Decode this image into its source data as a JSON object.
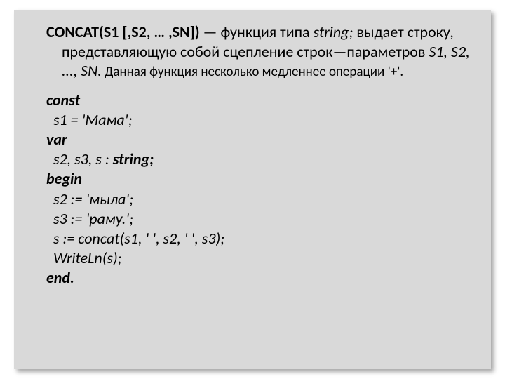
{
  "desc": {
    "sig": "CONCAT(S1 [,S2, … ,SN])",
    "dash": " — функция типа ",
    "type": "string;",
    "body1": " выдает строку, представляющую собой сцепление строк—параметров ",
    "params": "S1, S2, ..., SN.",
    "note": " Данная функция несколько медленнее операции '+'."
  },
  "code": {
    "const": "const",
    "l1": "  s1 = 'Мама';",
    "var": "var",
    "l2": "  s2, s3, s : ",
    "stringkw": "string;",
    "begin": "begin",
    "l3": "  s2 := 'мыла';",
    "l4": "  s3 := 'раму.';",
    "l5": "  s := concat(s1, ' ', s2, ' ', s3);",
    "l6": "  WriteLn(s);",
    "end": "end."
  }
}
